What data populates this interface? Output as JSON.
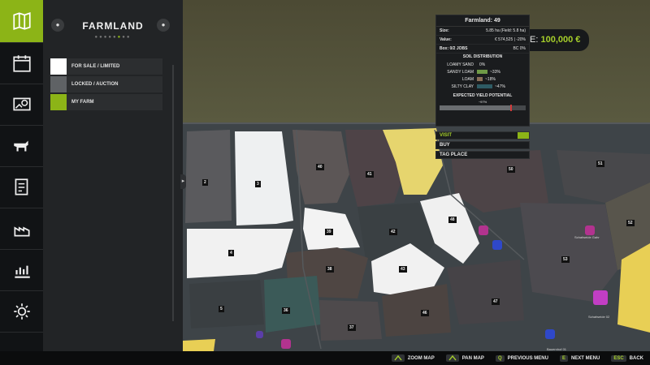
{
  "panel": {
    "title": "FARMLAND",
    "legend": [
      {
        "label": "FOR SALE / LIMITED",
        "color": "#ffffff"
      },
      {
        "label": "LOCKED / AUCTION",
        "color": "#5f6265"
      },
      {
        "label": "MY FARM",
        "color": "#8cb417"
      }
    ]
  },
  "balance": {
    "prefix": "E:",
    "value": "100,000 €"
  },
  "info": {
    "title": "Farmland: 49",
    "size_label": "Size:",
    "size_value": "5.85 ha (Field: 5.8 ha)",
    "value_label": "Value:",
    "value_value": "€ 574,525 | -20%",
    "box_left": "Box: 0/2 JOBS",
    "box_right": "BC 0%",
    "soil_title": "SOIL DISTRIBUTION",
    "soil": [
      {
        "name": "LOAMY SAND",
        "pct": "0%",
        "frac": 0,
        "color": "#c8b14a"
      },
      {
        "name": "SANDY LOAM",
        "pct": "~33%",
        "frac": 0.33,
        "color": "#6f9a46"
      },
      {
        "name": "LOAM",
        "pct": "~18%",
        "frac": 0.18,
        "color": "#8a6f58"
      },
      {
        "name": "SILTY CLAY",
        "pct": "~47%",
        "frac": 0.47,
        "color": "#2e5b64"
      }
    ],
    "yield_title": "EXPECTED YIELD POTENTIAL",
    "yield_value": "~97%",
    "yield_frac": 0.97
  },
  "actions": {
    "visit": "VISIT",
    "buy": "BUY",
    "tag": "TAG PLACE"
  },
  "fields": [
    {
      "n": "2"
    },
    {
      "n": "3"
    },
    {
      "n": "40"
    },
    {
      "n": "41"
    },
    {
      "n": "50"
    },
    {
      "n": "51"
    },
    {
      "n": "39"
    },
    {
      "n": "42"
    },
    {
      "n": "48"
    },
    {
      "n": "52"
    },
    {
      "n": "4"
    },
    {
      "n": "38"
    },
    {
      "n": "43"
    },
    {
      "n": "53"
    },
    {
      "n": "5"
    },
    {
      "n": "36"
    },
    {
      "n": "47"
    },
    {
      "n": "46"
    },
    {
      "n": "37"
    }
  ],
  "pois": {
    "p1": "Schafweide Gahr",
    "p2": "Schafweide 02",
    "p3": "Bauernhof 01"
  },
  "bottom": {
    "zoom": "ZOOM MAP",
    "pan": "PAN MAP",
    "q_key": "Q",
    "prev": "PREVIOUS MENU",
    "e_key": "E",
    "next": "NEXT MENU",
    "esc_key": "ESC",
    "back": "BACK"
  }
}
